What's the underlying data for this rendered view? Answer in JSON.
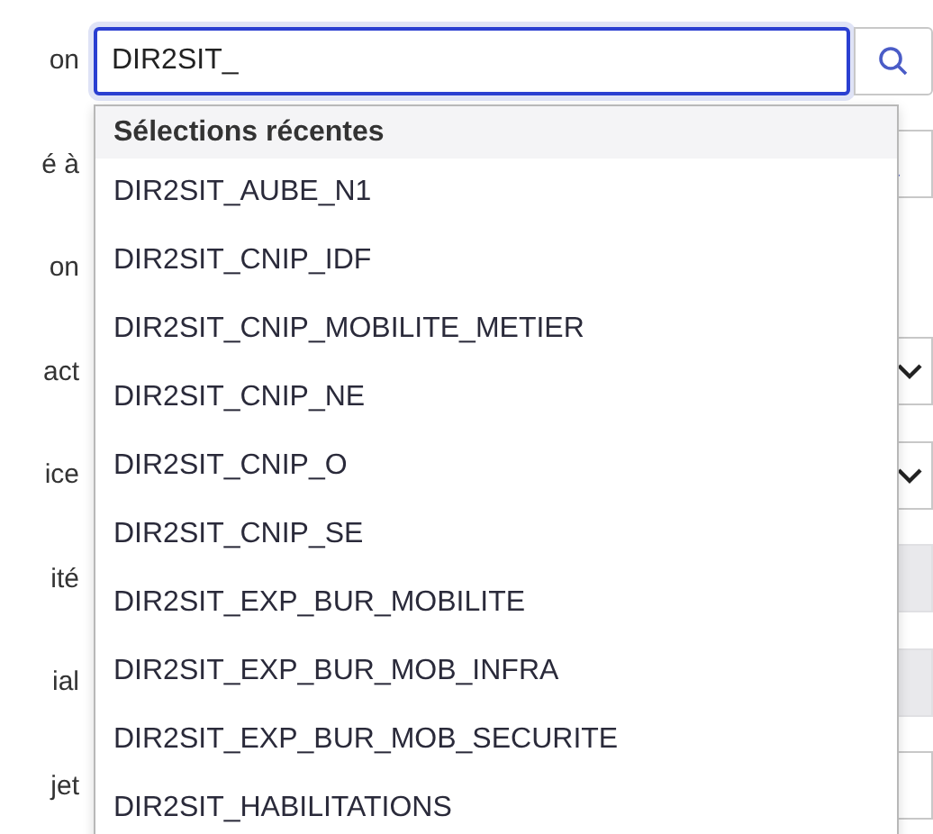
{
  "form_rows": [
    {
      "label": "on",
      "kind": "search"
    },
    {
      "label": "é à",
      "kind": "lookup"
    },
    {
      "label": "on",
      "kind": "blank"
    },
    {
      "label": "act",
      "kind": "select"
    },
    {
      "label": "ice",
      "kind": "select"
    },
    {
      "label": "ité",
      "kind": "readonly"
    },
    {
      "label": "ial",
      "kind": "readonly"
    },
    {
      "label": "jet",
      "kind": "text"
    }
  ],
  "search": {
    "value": "DIR2SIT_"
  },
  "dropdown": {
    "header": "Sélections récentes",
    "items": [
      "DIR2SIT_AUBE_N1",
      "DIR2SIT_CNIP_IDF",
      "DIR2SIT_CNIP_MOBILITE_METIER",
      "DIR2SIT_CNIP_NE",
      "DIR2SIT_CNIP_O",
      "DIR2SIT_CNIP_SE",
      "DIR2SIT_EXP_BUR_MOBILITE",
      "DIR2SIT_EXP_BUR_MOB_INFRA",
      "DIR2SIT_EXP_BUR_MOB_SECURITE",
      "DIR2SIT_HABILITATIONS"
    ]
  }
}
